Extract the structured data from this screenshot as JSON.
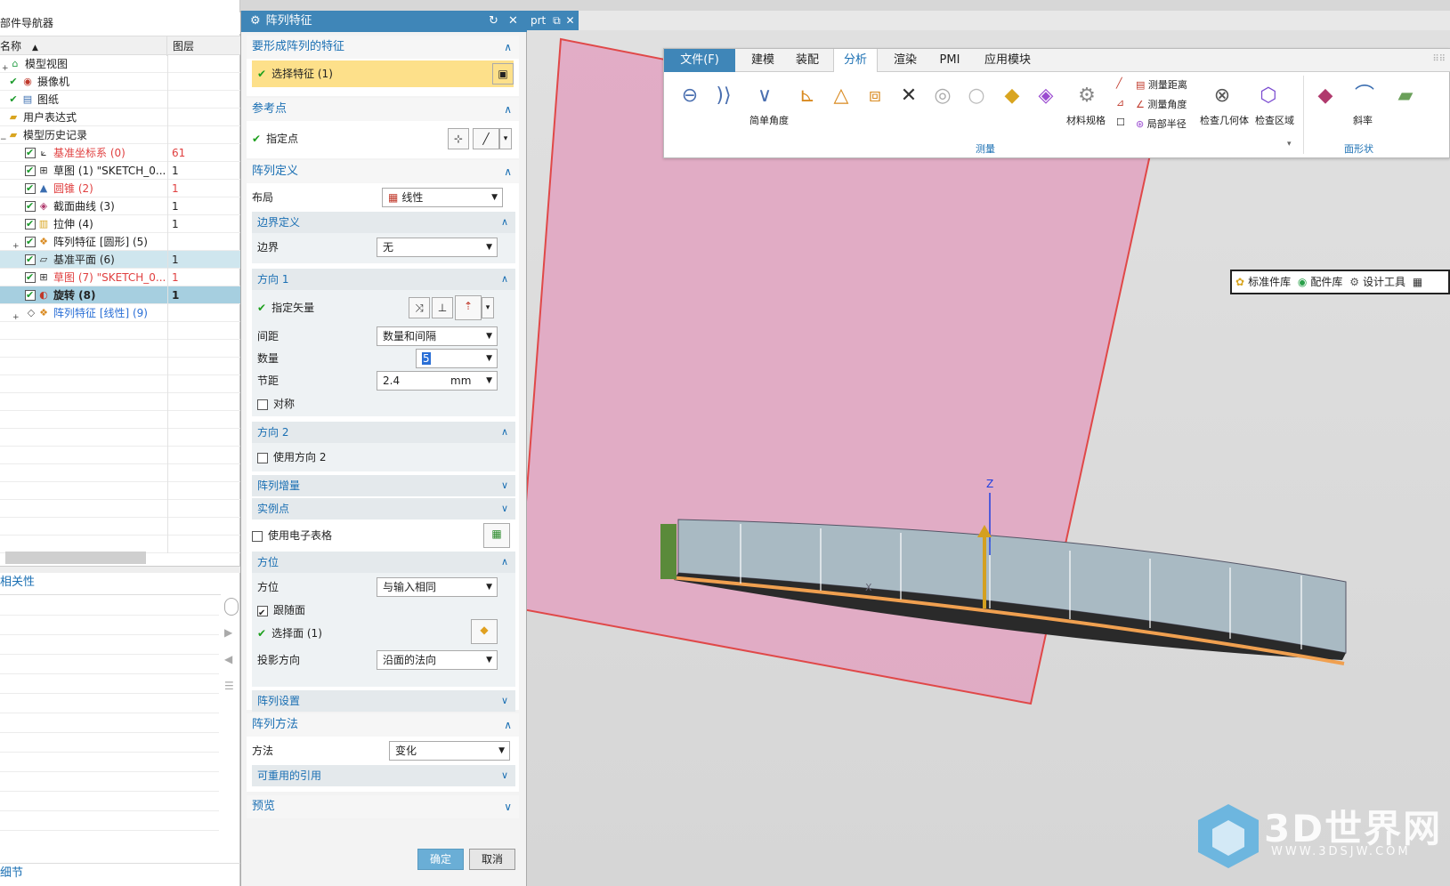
{
  "navigator": {
    "title": "部件导航器",
    "col_name": "名称",
    "col_layer": "图层",
    "rows": [
      {
        "label": "模型视图",
        "layer": ""
      },
      {
        "label": "摄像机",
        "layer": ""
      },
      {
        "label": "图纸",
        "layer": ""
      },
      {
        "label": "用户表达式",
        "layer": ""
      },
      {
        "label": "模型历史记录",
        "layer": ""
      },
      {
        "label": "基准坐标系 (0)",
        "layer": "61"
      },
      {
        "label": "草图 (1) \"SKETCH_0...",
        "layer": "1"
      },
      {
        "label": "圆锥 (2)",
        "layer": "1"
      },
      {
        "label": "截面曲线 (3)",
        "layer": "1"
      },
      {
        "label": "拉伸 (4)",
        "layer": "1"
      },
      {
        "label": "阵列特征 [圆形] (5)",
        "layer": ""
      },
      {
        "label": "基准平面 (6)",
        "layer": "1"
      },
      {
        "label": "草图 (7) \"SKETCH_0...",
        "layer": "1"
      },
      {
        "label": "旋转 (8)",
        "layer": "1"
      },
      {
        "label": "阵列特征 [线性] (9)",
        "layer": ""
      }
    ],
    "relations_title": "相关性",
    "details_title": "细节"
  },
  "dialog": {
    "title": "阵列特征",
    "features_section": "要形成阵列的特征",
    "select_feature": "选择特征 (1)",
    "reference_section": "参考点",
    "specify_point": "指定点",
    "definition_section": "阵列定义",
    "layout_label": "布局",
    "layout_value": "线性",
    "boundary_section": "边界定义",
    "boundary_label": "边界",
    "boundary_value": "无",
    "direction1_section": "方向 1",
    "specify_vector": "指定矢量",
    "spacing_label": "间距",
    "spacing_value": "数量和间隔",
    "count_label": "数量",
    "count_value": "5",
    "pitch_label": "节距",
    "pitch_value": "2.4",
    "pitch_unit": "mm",
    "symmetric_label": "对称",
    "direction2_section": "方向 2",
    "use_direction2": "使用方向 2",
    "increment_section": "阵列增量",
    "instance_section": "实例点",
    "use_spreadsheet": "使用电子表格",
    "orientation_section": "方位",
    "orientation_label": "方位",
    "orientation_value": "与输入相同",
    "follow_face": "跟随面",
    "select_face": "选择面 (1)",
    "projection_label": "投影方向",
    "projection_value": "沿面的法向",
    "settings_section": "阵列设置",
    "method_section": "阵列方法",
    "method_label": "方法",
    "method_value": "变化",
    "reusable_section": "可重用的引用",
    "preview_section": "预览",
    "ok_label": "确定",
    "cancel_label": "取消"
  },
  "part_tab": "prt",
  "ribbon": {
    "tabs": [
      "文件(F)",
      "建模",
      "装配",
      "分析",
      "渲染",
      "PMI",
      "应用模块"
    ],
    "active_tab": "分析",
    "simple_angle": "简单角度",
    "material_spec": "材料规格",
    "measure_distance": "测量距离",
    "measure_angle": "测量角度",
    "local_radius": "局部半径",
    "check_geometry": "检查几何体",
    "check_region": "检查区域",
    "slope": "斜率",
    "group_measure": "测量",
    "group_face_shape": "面形状"
  },
  "library_bar": {
    "std_lib": "标准件库",
    "parts_lib": "配件库",
    "design_tools": "设计工具"
  },
  "viewport": {
    "axis_z": "Z",
    "axis_x": "X"
  },
  "watermark": {
    "text": "3D世界网",
    "sub": "WWW.3DSJW.COM"
  },
  "colors": {
    "accent": "#3f86b8",
    "selection_yellow": "#fde08a",
    "plane_fill": "#e8a6c4",
    "plane_edge": "#e04848",
    "ring_edge": "#f0a050"
  }
}
